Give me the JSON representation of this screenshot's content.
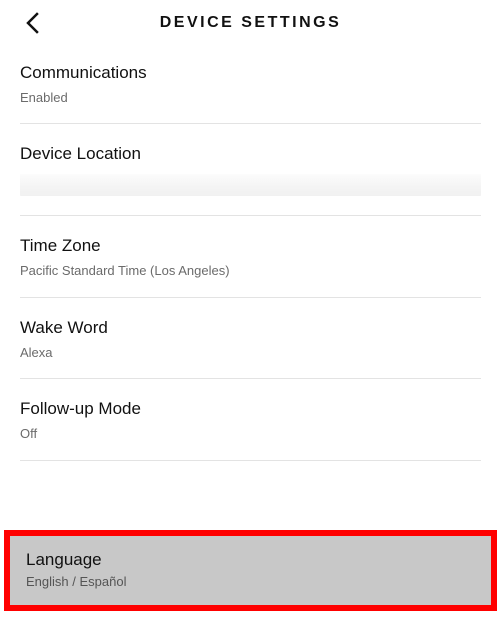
{
  "header": {
    "title": "DEVICE SETTINGS"
  },
  "sections": {
    "communications": {
      "title": "Communications",
      "value": "Enabled"
    },
    "location": {
      "title": "Device Location"
    },
    "timezone": {
      "title": "Time Zone",
      "value": "Pacific Standard Time (Los Angeles)"
    },
    "wakeword": {
      "title": "Wake Word",
      "value": "Alexa"
    },
    "followup": {
      "title": "Follow-up Mode",
      "value": "Off"
    },
    "language": {
      "title": "Language",
      "value": "English / Español"
    }
  }
}
